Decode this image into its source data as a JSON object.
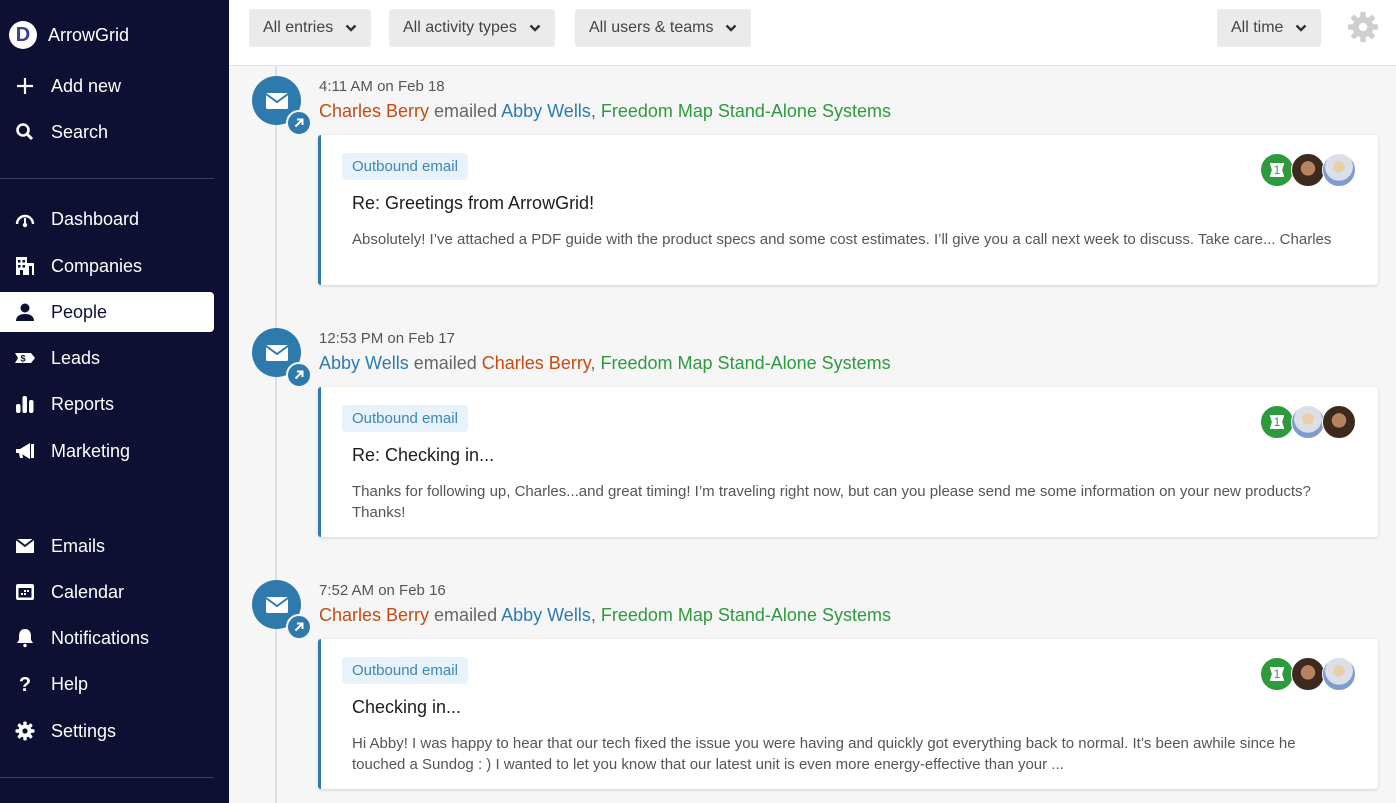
{
  "sidebar": {
    "brand": {
      "logo_letter": "D",
      "name": "ArrowGrid"
    },
    "top_actions": [
      {
        "label": "Add new",
        "icon": "plus-icon"
      },
      {
        "label": "Search",
        "icon": "search-icon"
      }
    ],
    "nav": [
      {
        "label": "Dashboard",
        "icon": "gauge-icon",
        "active": false
      },
      {
        "label": "Companies",
        "icon": "building-icon",
        "active": false
      },
      {
        "label": "People",
        "icon": "person-icon",
        "active": true
      },
      {
        "label": "Leads",
        "icon": "ticket-dollar-icon",
        "active": false
      },
      {
        "label": "Reports",
        "icon": "bar-chart-icon",
        "active": false
      },
      {
        "label": "Marketing",
        "icon": "megaphone-icon",
        "active": false
      }
    ],
    "bottom": [
      {
        "label": "Emails",
        "icon": "envelope-icon"
      },
      {
        "label": "Calendar",
        "icon": "calendar-icon"
      },
      {
        "label": "Notifications",
        "icon": "bell-icon"
      },
      {
        "label": "Help",
        "icon": "question-icon"
      },
      {
        "label": "Settings",
        "icon": "gear-icon"
      }
    ]
  },
  "filters": {
    "entries": "All entries",
    "activity_types": "All activity types",
    "users_teams": "All users & teams",
    "time": "All time"
  },
  "colors": {
    "sidebar_bg": "#0d0f33",
    "accent_blue": "#2e7aad",
    "person_orange": "#c54b12",
    "person_blue": "#2c7bb0",
    "company_green": "#2e9a3e"
  },
  "timeline": [
    {
      "timestamp": "4:11 AM on Feb 18",
      "sender": "Charles Berry",
      "sender_color": "orange",
      "verb": "emailed",
      "recipient": "Abby Wells",
      "recipient_color": "blue",
      "separator": ",",
      "company": "Freedom Map Stand-Alone Systems",
      "tag": "Outbound email",
      "subject": "Re: Greetings from ArrowGrid!",
      "body": "Absolutely! I’ve attached a PDF guide with the product specs and some cost estimates. I’ll give you a call next week to discuss. Take care... Charles",
      "count": "1",
      "participants": [
        "man",
        "woman"
      ]
    },
    {
      "timestamp": "12:53 PM on Feb 17",
      "sender": "Abby Wells",
      "sender_color": "blue",
      "verb": "emailed",
      "recipient": "Charles Berry",
      "recipient_color": "orange",
      "separator": ",",
      "company": "Freedom Map Stand-Alone Systems",
      "tag": "Outbound email",
      "subject": "Re: Checking in...",
      "body": "Thanks for following up, Charles...and great timing! I’m traveling right now, but can you please send me some information on your new products? Thanks!",
      "count": "1",
      "participants": [
        "woman",
        "man"
      ]
    },
    {
      "timestamp": "7:52 AM on Feb 16",
      "sender": "Charles Berry",
      "sender_color": "orange",
      "verb": "emailed",
      "recipient": "Abby Wells",
      "recipient_color": "blue",
      "separator": ",",
      "company": "Freedom Map Stand-Alone Systems",
      "tag": "Outbound email",
      "subject": "Checking in...",
      "body": "Hi Abby! I was happy to hear that our tech fixed the issue you were having and quickly got everything back to normal. It’s been awhile since he touched a Sundog : ) I wanted to let you know that our latest unit is even more energy-effective than your ...",
      "count": "1",
      "participants": [
        "man",
        "woman"
      ]
    }
  ]
}
